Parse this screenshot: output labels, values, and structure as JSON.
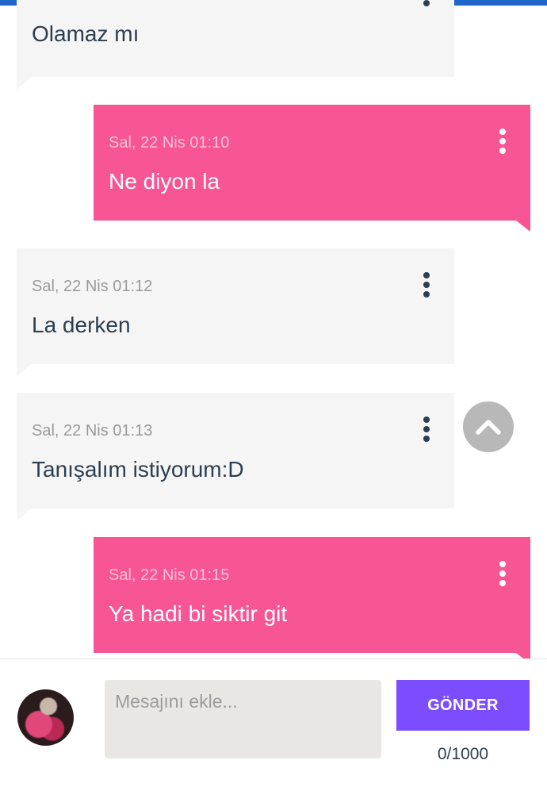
{
  "messages": [
    {
      "direction": "in",
      "timestamp": "",
      "text": "Olamaz mı"
    },
    {
      "direction": "out",
      "timestamp": "Sal, 22 Nis 01:10",
      "text": "Ne diyon la"
    },
    {
      "direction": "in",
      "timestamp": "Sal, 22 Nis 01:12",
      "text": "La derken"
    },
    {
      "direction": "in",
      "timestamp": "Sal, 22 Nis 01:13",
      "text": "Tanışalım istiyorum:D"
    },
    {
      "direction": "out",
      "timestamp": "Sal, 22 Nis 01:15",
      "text": "Ya hadi bi siktir git"
    }
  ],
  "composer": {
    "placeholder": "Mesajını ekle...",
    "value": "",
    "send_label": "GÖNDER",
    "char_count": "0/1000"
  },
  "icons": {
    "message_menu": "kebab-menu-icon",
    "scroll_top": "chevron-up-icon",
    "avatar": "user-avatar"
  },
  "colors": {
    "top_bar": "#1f66c9",
    "incoming_bubble": "#f5f5f5",
    "outgoing_bubble": "#f75593",
    "send_button": "#7c4dff",
    "input_background": "#e8e7e3"
  }
}
